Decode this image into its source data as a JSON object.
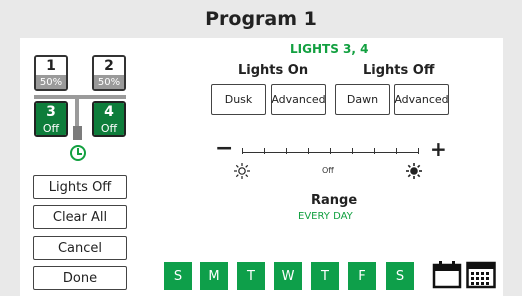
{
  "header": {
    "title": "Program 1"
  },
  "zones": [
    {
      "number": "1",
      "level": "50%"
    },
    {
      "number": "2",
      "level": "50%"
    },
    {
      "number": "3",
      "level": "Off"
    },
    {
      "number": "4",
      "level": "Off"
    }
  ],
  "side_buttons": {
    "lights_off": "Lights Off",
    "clear_all": "Clear All",
    "cancel": "Cancel",
    "done": "Done"
  },
  "lights_group": "LIGHTS 3, 4",
  "lights_on": {
    "label": "Lights On",
    "dusk": "Dusk",
    "advanced": "Advanced"
  },
  "lights_off": {
    "label": "Lights Off",
    "dawn": "Dawn",
    "advanced": "Advanced"
  },
  "dimmer": {
    "minus": "−",
    "plus": "+",
    "value": "Off"
  },
  "range": {
    "label": "Range",
    "value": "EVERY DAY"
  },
  "days": [
    "S",
    "M",
    "T",
    "W",
    "T",
    "F",
    "S"
  ],
  "colors": {
    "accent": "#0e9f4a",
    "dark_green": "#0e7d3b",
    "zone_level_gray": "#9a9a9a"
  }
}
